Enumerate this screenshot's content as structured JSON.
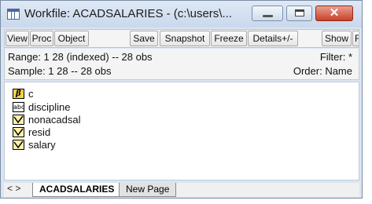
{
  "window": {
    "title": "Workfile: ACADSALARIES - (c:\\users\\..."
  },
  "toolbar": [
    {
      "label": "View"
    },
    {
      "label": "Proc"
    },
    {
      "label": "Object"
    },
    {
      "label": "Save"
    },
    {
      "label": "Snapshot"
    },
    {
      "label": "Freeze"
    },
    {
      "label": "Details+/-"
    },
    {
      "label": "Show"
    },
    {
      "label": "Fe"
    }
  ],
  "info": {
    "range": "Range:  1 28 (indexed)  --  28 obs",
    "filter": "Filter: *",
    "sample": "Sample: 1 28  --  28 obs",
    "order": "Order: Name"
  },
  "objects": [
    {
      "name": "c",
      "icon": "coef-vector-icon"
    },
    {
      "name": "discipline",
      "icon": "alpha-series-icon"
    },
    {
      "name": "nonacadsal",
      "icon": "series-icon"
    },
    {
      "name": "resid",
      "icon": "series-icon"
    },
    {
      "name": "salary",
      "icon": "series-icon"
    }
  ],
  "tabs": {
    "nav": "< >",
    "active": "ACADSALARIES",
    "new_page": "New Page"
  },
  "icon_glyphs": {
    "coef": "β",
    "alpha": "abc"
  },
  "colors": {
    "titlebar": "#c9d8ec",
    "close": "#c8412a",
    "series_icon": "#fff1a8",
    "coef_icon": "#f5d04b"
  }
}
